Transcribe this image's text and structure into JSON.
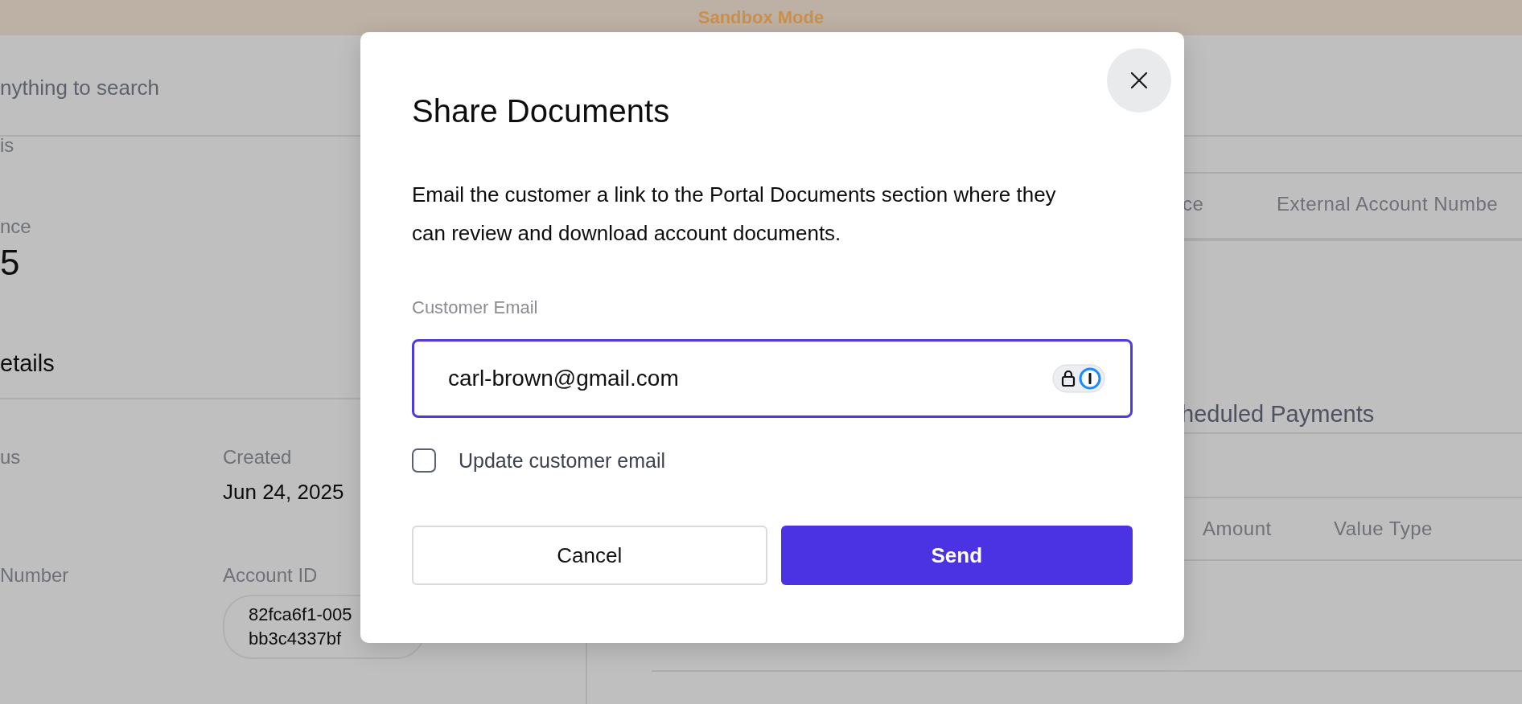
{
  "sandbox_banner": "Sandbox Mode",
  "search": {
    "placeholder": "nything to search"
  },
  "account": {
    "section_label": "is",
    "balance_label": "nce",
    "balance_value": "5",
    "details_title": "etails",
    "fields": [
      {
        "label": "us",
        "kind": "text"
      },
      {
        "label": "Created",
        "kind": "text",
        "value": "Jun 24, 2025"
      },
      {
        "label": "Number",
        "kind": "text"
      },
      {
        "label": "Account ID",
        "kind": "pill",
        "value_lines": [
          "82fca6f1-005",
          "bb3c4337bf"
        ]
      }
    ]
  },
  "accounts_table": {
    "columns": [
      "ce",
      "External Account Numbe"
    ]
  },
  "scheduled_payments": {
    "title": "heduled Payments",
    "columns": [
      "Amount",
      "Value Type"
    ]
  },
  "dialog": {
    "title": "Share Documents",
    "description": "Email the customer a link to the Portal Documents section where they can review and download account documents.",
    "email_label": "Customer Email",
    "email_value": "carl-brown@gmail.com",
    "update_checkbox": {
      "label": "Update customer email",
      "checked": false
    },
    "buttons": [
      {
        "label": "Cancel",
        "kind": "secondary"
      },
      {
        "label": "Send",
        "kind": "primary"
      }
    ]
  }
}
